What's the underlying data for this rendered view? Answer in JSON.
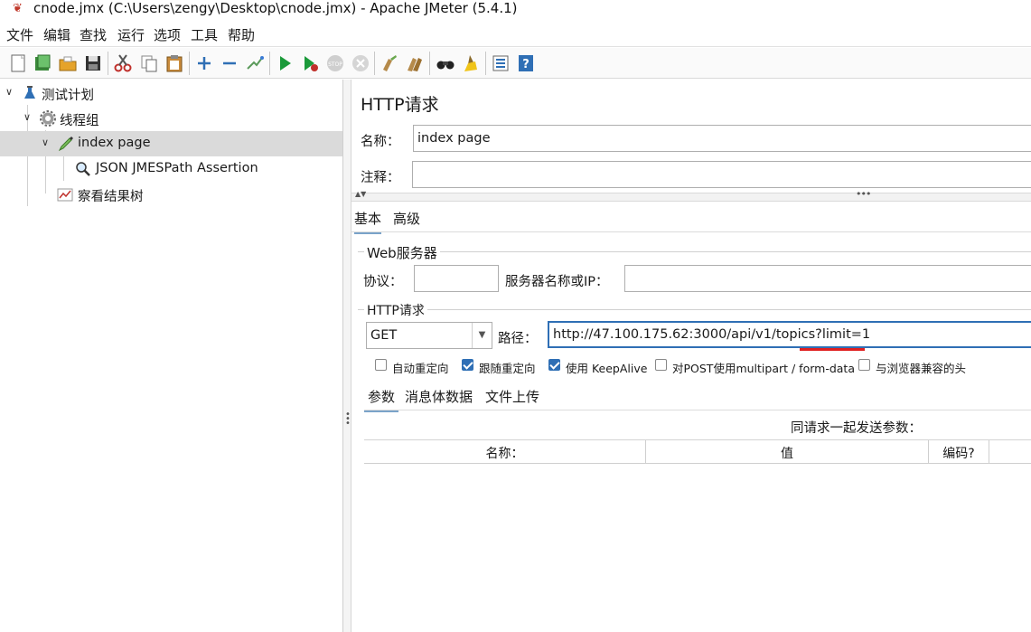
{
  "window": {
    "title": "cnode.jmx (C:\\Users\\zengy\\Desktop\\cnode.jmx) - Apache JMeter (5.4.1)"
  },
  "menu": [
    "文件",
    "编辑",
    "查找",
    "运行",
    "选项",
    "工具",
    "帮助"
  ],
  "toolbar_icons": [
    "new-icon",
    "templates-icon",
    "open-icon",
    "save-icon",
    "cut-icon",
    "copy-icon",
    "paste-icon",
    "expand-icon",
    "collapse-icon",
    "toggle-icon",
    "start-icon",
    "start-no-pause-icon",
    "stop-icon",
    "shutdown-icon",
    "clear-icon",
    "clear-all-icon",
    "search-icon",
    "reset-search-icon",
    "function-helper-icon",
    "help-icon"
  ],
  "tree": {
    "items": [
      {
        "label": "测试计划",
        "icon": "flask-icon"
      },
      {
        "label": "线程组",
        "icon": "gear-icon"
      },
      {
        "label": "index page",
        "icon": "pen-icon",
        "selected": true
      },
      {
        "label": "JSON JMESPath Assertion",
        "icon": "magnifier-icon"
      },
      {
        "label": "察看结果树",
        "icon": "graph-icon"
      }
    ]
  },
  "panel": {
    "title": "HTTP请求",
    "name_label": "名称：",
    "name_value": "index page",
    "comment_label": "注释：",
    "comment_value": "",
    "tabs": [
      "基本",
      "高级"
    ],
    "web_server": {
      "legend": "Web服务器",
      "protocol_label": "协议：",
      "protocol_value": "",
      "server_label": "服务器名称或IP：",
      "server_value": ""
    },
    "http_request": {
      "legend": "HTTP请求",
      "method": "GET",
      "path_label": "路径：",
      "path_value": "http://47.100.175.62:3000/api/v1/topics?limit=1"
    },
    "options": [
      {
        "label": "自动重定向",
        "checked": false
      },
      {
        "label": "跟随重定向",
        "checked": true
      },
      {
        "label": "使用 KeepAlive",
        "checked": true
      },
      {
        "label": "对POST使用multipart / form-data",
        "checked": false
      },
      {
        "label": "与浏览器兼容的头",
        "checked": false
      }
    ],
    "subtabs": [
      "参数",
      "消息体数据",
      "文件上传"
    ],
    "params_caption": "同请求一起发送参数：",
    "table_headers": [
      "名称：",
      "值",
      "编码?"
    ],
    "colors": {
      "accent": "#2f6fb5",
      "underline": "#e02020",
      "selected_row": "#dadada"
    }
  }
}
